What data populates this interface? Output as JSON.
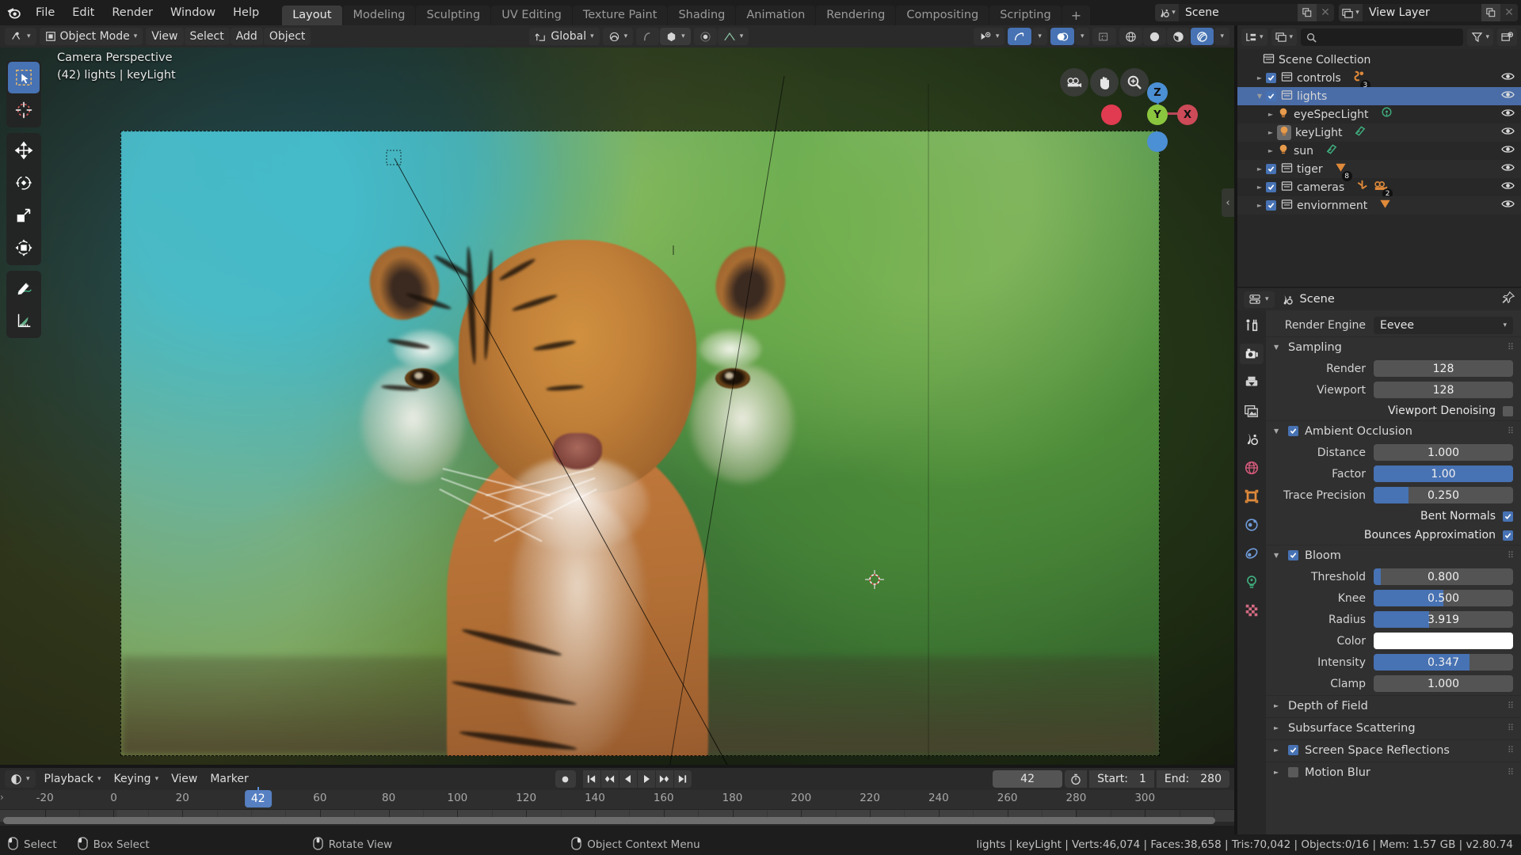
{
  "app": {
    "logo_icon": "blender-logo",
    "menus": [
      "File",
      "Edit",
      "Render",
      "Window",
      "Help"
    ],
    "workspaces": [
      {
        "label": "Layout",
        "active": true
      },
      {
        "label": "Modeling",
        "active": false
      },
      {
        "label": "Sculpting",
        "active": false
      },
      {
        "label": "UV Editing",
        "active": false
      },
      {
        "label": "Texture Paint",
        "active": false
      },
      {
        "label": "Shading",
        "active": false
      },
      {
        "label": "Animation",
        "active": false
      },
      {
        "label": "Rendering",
        "active": false
      },
      {
        "label": "Compositing",
        "active": false
      },
      {
        "label": "Scripting",
        "active": false
      }
    ],
    "add_workspace_label": "+",
    "scene_block": {
      "icon": "scene-icon",
      "name": "Scene",
      "copy_icon": "duplicate-icon",
      "close_icon": "x-icon"
    },
    "viewlayer_block": {
      "icon": "viewlayer-icon",
      "name": "View Layer",
      "copy_icon": "duplicate-icon",
      "close_icon": "x-icon"
    }
  },
  "viewport_header": {
    "editor_type_icon": "editor-type-icon",
    "mode": "Object Mode",
    "menus": [
      "View",
      "Select",
      "Add",
      "Object"
    ],
    "transform_orientation": "Global",
    "snap_icon": "snap-magnet-icon",
    "proportional_icon": "proportional-edit-icon",
    "pivot_icon": "pivot-point-icon",
    "falloff_icon": "falloff-curve-icon",
    "visibility_icon": "object-visibility-icon",
    "gizmo_icon": "gizmo-icon",
    "overlays_icon": "overlays-icon",
    "xray_icon": "xray-icon",
    "shading_modes": [
      "wireframe",
      "solid",
      "material-preview",
      "rendered"
    ],
    "shading_active": "rendered"
  },
  "viewport": {
    "info_line1": "Camera Perspective",
    "info_line2": "(42) lights | keyLight",
    "tools": [
      {
        "name": "tweak-select-tool",
        "active": true
      },
      {
        "name": "cursor-tool",
        "active": false
      },
      {
        "name": "move-tool",
        "active": false
      },
      {
        "name": "rotate-tool",
        "active": false
      },
      {
        "name": "scale-tool",
        "active": false
      },
      {
        "name": "transform-tool",
        "active": false
      },
      {
        "name": "annotate-tool",
        "active": false
      },
      {
        "name": "measure-tool",
        "active": false
      }
    ],
    "nav_buttons": [
      "camera-view-icon",
      "pan-view-icon",
      "zoom-view-icon"
    ],
    "axis_labels": {
      "z": "Z",
      "y": "Y",
      "x": "X"
    },
    "axis_colors": {
      "x": "#cd4a58",
      "y": "#8bc63f",
      "z": "#4b8fd4"
    }
  },
  "outliner": {
    "display_mode_icon": "outliner-display-mode-icon",
    "filter_id_icon": "outliner-id-type-icon",
    "search_placeholder": "",
    "search_value": "",
    "search_icon": "search-icon",
    "filter_icon": "filter-funnel-icon",
    "new_collection_icon": "new-collection-icon",
    "root": "Scene Collection",
    "rows": [
      {
        "label": "controls",
        "indent": 1,
        "type": "collection",
        "expanded": false,
        "checked": true,
        "selected": false,
        "badges": [
          {
            "icon": "armature-icon",
            "count": "3",
            "color": "#e08a3a"
          }
        ],
        "visible": true
      },
      {
        "label": "lights",
        "indent": 1,
        "type": "collection",
        "expanded": true,
        "checked": true,
        "selected": true,
        "badges": [],
        "visible": true
      },
      {
        "label": "eyeSpecLight",
        "indent": 2,
        "type": "light",
        "expanded": false,
        "checked": null,
        "selected": false,
        "badges": [
          {
            "icon": "light-point-icon",
            "count": "",
            "color": "#3fae7e"
          }
        ],
        "visible": true
      },
      {
        "label": "keyLight",
        "indent": 2,
        "type": "light",
        "expanded": false,
        "checked": null,
        "selected": false,
        "highlight": true,
        "badges": [
          {
            "icon": "light-area-icon",
            "count": "",
            "color": "#3fae7e"
          }
        ],
        "visible": true
      },
      {
        "label": "sun",
        "indent": 2,
        "type": "light",
        "expanded": false,
        "checked": null,
        "selected": false,
        "badges": [
          {
            "icon": "light-area-icon",
            "count": "",
            "color": "#3fae7e"
          }
        ],
        "visible": true
      },
      {
        "label": "tiger",
        "indent": 1,
        "type": "collection",
        "expanded": false,
        "checked": true,
        "selected": false,
        "badges": [
          {
            "icon": "mesh-data-icon",
            "count": "8",
            "color": "#e08a3a"
          }
        ],
        "visible": true
      },
      {
        "label": "cameras",
        "indent": 1,
        "type": "collection",
        "expanded": false,
        "checked": true,
        "selected": false,
        "badges": [
          {
            "icon": "empty-axis-icon",
            "count": "",
            "color": "#e08a3a"
          },
          {
            "icon": "camera-data-icon",
            "count": "2",
            "color": "#e08a3a"
          }
        ],
        "visible": true
      },
      {
        "label": "enviornment",
        "indent": 1,
        "type": "collection",
        "expanded": false,
        "checked": true,
        "selected": false,
        "badges": [
          {
            "icon": "mesh-data-icon",
            "count": "",
            "color": "#e08a3a"
          }
        ],
        "visible": true
      }
    ]
  },
  "properties": {
    "editor_icon": "properties-editor-icon",
    "breadcrumb_icon": "scene-icon",
    "breadcrumb": "Scene",
    "pin_icon": "pin-icon",
    "tabs": [
      {
        "name": "tool-tab",
        "icon": "tool-icon",
        "active": false
      },
      {
        "name": "render-tab",
        "icon": "render-camera-icon",
        "active": true
      },
      {
        "name": "output-tab",
        "icon": "printer-icon",
        "active": false
      },
      {
        "name": "viewlayer-tab",
        "icon": "images-icon",
        "active": false
      },
      {
        "name": "scene-tab",
        "icon": "scene-cone-icon",
        "active": false
      },
      {
        "name": "world-tab",
        "icon": "world-globe-icon",
        "active": false
      },
      {
        "name": "object-tab",
        "icon": "object-square-icon",
        "active": false
      },
      {
        "name": "physics-tab",
        "icon": "physics-orbit-icon",
        "active": false
      },
      {
        "name": "constraints-tab",
        "icon": "constraint-icon",
        "active": false
      },
      {
        "name": "data-tab",
        "icon": "light-data-icon",
        "active": false
      },
      {
        "name": "material-tab",
        "icon": "material-checker-icon",
        "active": false
      }
    ],
    "render_engine": {
      "label": "Render Engine",
      "value": "Eevee"
    },
    "sections": [
      {
        "name": "Sampling",
        "open": true,
        "checkbox": null,
        "fields": [
          {
            "label": "Render",
            "value": "128",
            "type": "number",
            "fill": 0
          },
          {
            "label": "Viewport",
            "value": "128",
            "type": "number",
            "fill": 0
          }
        ],
        "checks": [
          {
            "label": "Viewport Denoising",
            "checked": false
          }
        ]
      },
      {
        "name": "Ambient Occlusion",
        "open": true,
        "checkbox": true,
        "fields": [
          {
            "label": "Distance",
            "value": "1.000",
            "type": "number",
            "fill": 0
          },
          {
            "label": "Factor",
            "value": "1.00",
            "type": "slider",
            "fill": 100
          },
          {
            "label": "Trace Precision",
            "value": "0.250",
            "type": "slider",
            "fill": 25
          }
        ],
        "checks": [
          {
            "label": "Bent Normals",
            "checked": true
          },
          {
            "label": "Bounces Approximation",
            "checked": true
          }
        ]
      },
      {
        "name": "Bloom",
        "open": true,
        "checkbox": true,
        "fields": [
          {
            "label": "Threshold",
            "value": "0.800",
            "type": "slider",
            "fill": 5
          },
          {
            "label": "Knee",
            "value": "0.500",
            "type": "slider",
            "fill": 50
          },
          {
            "label": "Radius",
            "value": "3.919",
            "type": "slider",
            "fill": 40
          },
          {
            "label": "Color",
            "value": "",
            "type": "color",
            "fill": 0,
            "color": "#ffffff"
          },
          {
            "label": "Intensity",
            "value": "0.347",
            "type": "slider",
            "fill": 69
          },
          {
            "label": "Clamp",
            "value": "1.000",
            "type": "number",
            "fill": 0
          }
        ],
        "checks": []
      }
    ],
    "collapsed_sections": [
      {
        "name": "Depth of Field",
        "checkbox": null
      },
      {
        "name": "Subsurface Scattering",
        "checkbox": null
      },
      {
        "name": "Screen Space Reflections",
        "checkbox": true
      },
      {
        "name": "Motion Blur",
        "checkbox": false
      }
    ]
  },
  "timeline": {
    "editor_icon": "timeline-editor-icon",
    "menus": [
      "Playback",
      "Keying",
      "View",
      "Marker"
    ],
    "record_icon": "auto-keying-icon",
    "transport": [
      "jump-start-icon",
      "prev-keyframe-icon",
      "play-reverse-icon",
      "play-icon",
      "next-keyframe-icon",
      "jump-end-icon"
    ],
    "current_frame": "42",
    "clock_icon": "use-preview-range-icon",
    "start_label": "Start:",
    "start_value": "1",
    "end_label": "End:",
    "end_value": "280",
    "ruler_ticks": [
      "-20",
      "0",
      "20",
      "60",
      "80",
      "100",
      "120",
      "140",
      "160",
      "180",
      "200",
      "220",
      "240",
      "260",
      "280",
      "300"
    ],
    "playhead_frame": "42"
  },
  "statusbar": {
    "hints": [
      {
        "icon": "mouse-left-icon",
        "label": "Select"
      },
      {
        "icon": "mouse-left-drag-icon",
        "label": "Box Select"
      },
      {
        "icon": "mouse-middle-icon",
        "label": "Rotate View"
      },
      {
        "icon": "mouse-right-icon",
        "label": "Object Context Menu"
      }
    ],
    "stats": "lights | keyLight | Verts:46,074 | Faces:38,658 | Tris:70,042 | Objects:0/16 | Mem: 1.57 GB | v2.80.74"
  },
  "colors": {
    "accent": "#4772b3",
    "selection": "#4a6da8",
    "panel": "#303030",
    "header": "#2a2a2a",
    "background": "#1d1d1d",
    "orange": "#e08a3a",
    "green": "#3fae7e"
  }
}
